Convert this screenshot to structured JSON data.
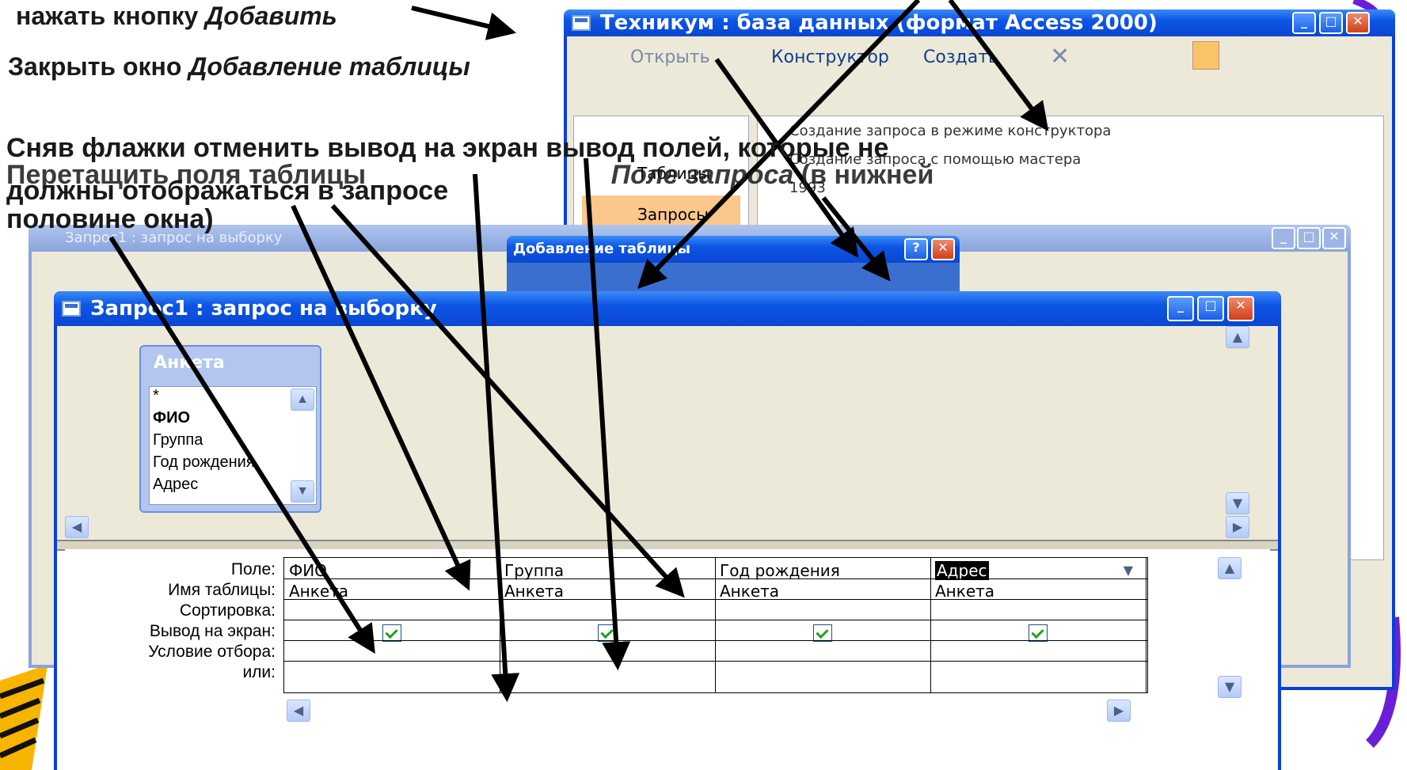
{
  "annotations": {
    "add_button_text": "нажать кнопку",
    "add_button_word": "Добавить",
    "close_window_text": "Закрыть окно",
    "close_window_word": "Добавление таблицы",
    "line1": "Сняв флажки отменить вывод на экран вывод полей, которые не",
    "line2": "должны отображаться в запросе",
    "line3a": "Перетащить поля таблицы",
    "line3b": "Поле запроса",
    "line3c": "(в нижней",
    "line4": "половине окна)"
  },
  "db_window": {
    "title": "Техникум : база данных (формат Access 2000)",
    "toolbar": {
      "open": "Открыть",
      "designer": "Конструктор",
      "create": "Создать"
    },
    "list": {
      "item1": "Создание запроса в режиме конструктора",
      "item2": "Создание запроса с помощью мастера",
      "item3": "1993"
    },
    "sidebar": {
      "tables": "Таблицы",
      "queries": "Запросы"
    }
  },
  "back_query_window": {
    "title": "Запрос1 : запрос на выборку"
  },
  "add_table_dialog": {
    "title": "Добавление таблицы"
  },
  "query_window": {
    "title": "Запрос1 : запрос на выборку",
    "table": {
      "name": "Анкета",
      "fields": [
        "*",
        "ФИО",
        "Группа",
        "Год рождения",
        "Адрес"
      ]
    },
    "grid": {
      "row_labels": [
        "Поле:",
        "Имя таблицы:",
        "Сортировка:",
        "Вывод на экран:",
        "Условие отбора:",
        "или:"
      ],
      "columns": [
        {
          "field": "ФИО",
          "table": "Анкета",
          "show": true
        },
        {
          "field": "Группа",
          "table": "Анкета",
          "show": true
        },
        {
          "field": "Год рождения",
          "table": "Анкета",
          "show": true
        },
        {
          "field": "Адрес",
          "table": "Анкета",
          "show": true
        }
      ]
    }
  },
  "colors": {
    "xp_title": "#0a47d2",
    "window_face": "#ece9d8",
    "accent_orange": "#f7b500",
    "accent_purple": "#6a1fd6"
  }
}
